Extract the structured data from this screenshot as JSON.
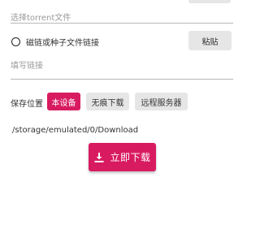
{
  "torrent": {
    "hint": "选择torrent文件"
  },
  "magnet": {
    "radio_label": "磁链或种子文件链接",
    "paste_label": "粘贴",
    "link_hint": "填写链接"
  },
  "save_location": {
    "label": "保存位置",
    "options": [
      {
        "label": "本设备",
        "selected": true
      },
      {
        "label": "无痕下载",
        "selected": false
      },
      {
        "label": "远程服务器",
        "selected": false
      }
    ]
  },
  "path": {
    "value": "/storage/emulated/0/Download"
  },
  "download": {
    "label": "立即下载",
    "icon": "download-icon"
  },
  "colors": {
    "accent": "#d81b60",
    "button_gray": "#e6e6e6",
    "hint_text": "#9a9a9a"
  }
}
